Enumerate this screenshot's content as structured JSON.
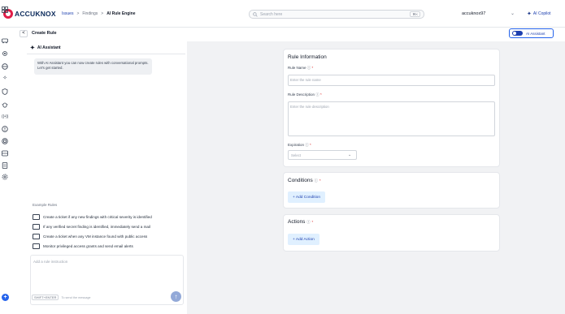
{
  "brand": {
    "name": "ACCUKNOX",
    "color": "#e11d48"
  },
  "breadcrumb": {
    "items": [
      "Issues",
      ">",
      "Findings",
      ">",
      "AI Rule Engine"
    ]
  },
  "search": {
    "placeholder": "Search here",
    "shortcut": "⌘K"
  },
  "account": {
    "name": "accuknox97",
    "chevron": "⌄"
  },
  "copilot": {
    "label": "AI Copilot",
    "icon": "sparkle-icon"
  },
  "header": {
    "back": "<",
    "title": "Create Rule",
    "ai_toggle_label": "AI Assistant",
    "ai_toggle_on": true
  },
  "rail": {
    "icons": [
      "dashboard-icon",
      "car-icon",
      "gear-icon",
      "layers-icon",
      "sparkle-icon",
      "shield-icon",
      "bug-icon",
      "radio-icon",
      "alert-icon",
      "target-icon",
      "grid-icon",
      "document-icon",
      "settings-icon"
    ],
    "bottom": "+"
  },
  "assistant": {
    "title": "AI Assistant",
    "welcome": "With AI Assistant you can now create rules with conversational prompts. Let's get started.",
    "examples_title": "Example Rules",
    "examples": [
      "Create a ticket if any new findings with critical severity is identified",
      "If any verified secret finding is identified, immediately send a mail",
      "Create a ticket when any VM instance found with public access",
      "Monitor privileged access grants and send email alerts"
    ],
    "input_placeholder": "Add a rule instruction",
    "hint_key": "SHIFT+ENTER",
    "hint_text": "To send the message",
    "send": "↑"
  },
  "rule_info": {
    "title": "Rule Information",
    "name_label": "Rule Name",
    "name_placeholder": "Enter the rule name",
    "desc_label": "Rule Description",
    "desc_placeholder": "Enter the rule description",
    "expiration_label": "Expiration",
    "expiration_value": "Select",
    "required": "*",
    "info_glyph": "ⓘ",
    "chevron": "⌄"
  },
  "conditions": {
    "title": "Conditions",
    "button": "+ Add Condition"
  },
  "actions": {
    "title": "Actions",
    "button": "+ Add Action"
  },
  "colors": {
    "accent": "#1e40af",
    "bubble": "#eef0f3",
    "background": "#f1f2f4",
    "required": "#dc2626"
  }
}
